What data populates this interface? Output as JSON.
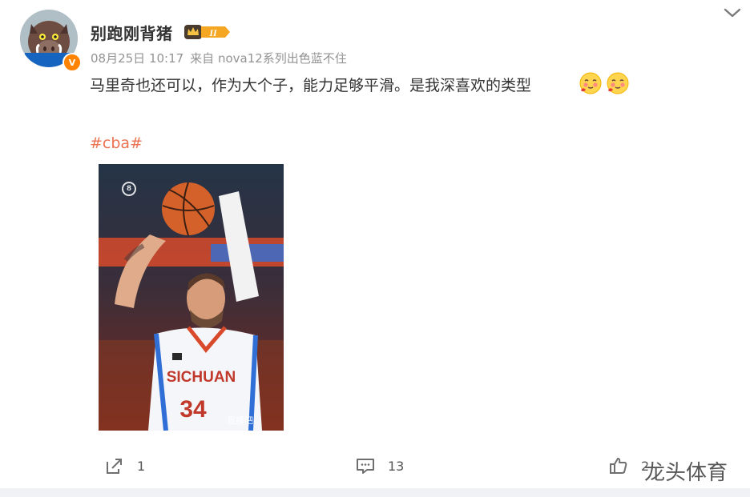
{
  "post": {
    "username": "别跑刚背猪",
    "vip_level": "II",
    "verified_mark": "V",
    "date": "08月25日 10:17",
    "source": "来自 nova12系列出色蓝不住",
    "text": "马里奇也还可以，作为大个子，能力足够平滑。是我深喜欢的类型",
    "emojis": [
      "blush-emoji",
      "blush-emoji"
    ],
    "hashtag": "#cba#"
  },
  "image": {
    "logo": "8",
    "jersey_text": "SICHUAN",
    "jersey_number": "34",
    "watermark": "直播吧"
  },
  "actions": {
    "share_count": "1",
    "comment_count": "13",
    "like_count": "2"
  },
  "overlay_watermark": "龙头体育",
  "icons": {
    "menu": "chevron-down-icon",
    "share": "share-icon",
    "comment": "comment-icon",
    "like": "thumbs-up-icon"
  },
  "colors": {
    "hashtag": "#eb7350",
    "meta_text": "#939393",
    "verified_badge": "#ff8200",
    "vip_badge": "#f5a623"
  }
}
